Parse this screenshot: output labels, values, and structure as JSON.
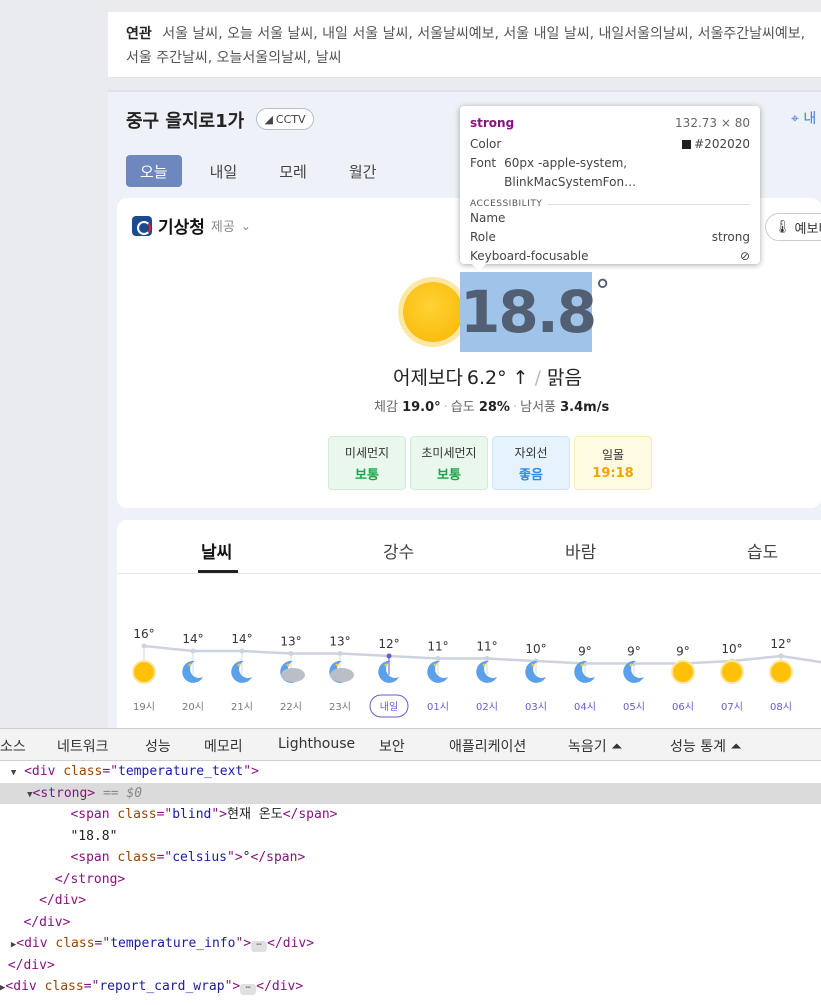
{
  "related": {
    "label": "연관",
    "text": "서울 날씨, 오늘 서울 날씨, 내일 서울 날씨, 서울날씨예보, 서울 내일 날씨, 내일서울의날씨, 서울주간날씨예보, 서울 주간날씨, 오늘서울의날씨, 날씨"
  },
  "weather": {
    "location": "중구 을지로1가",
    "cctv_label": "CCTV",
    "gps_label": "내",
    "tabs": [
      "오늘",
      "내일",
      "모레",
      "월간"
    ],
    "active_tab": "오늘",
    "agency": "기상청",
    "agency_sub": "제공",
    "forecast_btn": "예보비",
    "temperature": "18.8",
    "degree": "°",
    "compare_label": "어제보다",
    "compare_value": "6.2° ↑",
    "condition": "맑음",
    "feels_label": "체감",
    "feels_value": "19.0°",
    "humidity_label": "습도",
    "humidity_value": "28%",
    "wind_label": "남서풍",
    "wind_value": "3.4m/s",
    "badges": [
      {
        "label": "미세먼지",
        "value": "보통",
        "color": "#19a54a"
      },
      {
        "label": "초미세먼지",
        "value": "보통",
        "color": "#19a54a"
      },
      {
        "label": "자외선",
        "value": "좋음",
        "color": "#2f8de3"
      },
      {
        "label": "일몰",
        "value": "19:18",
        "color": "#f0a400"
      }
    ]
  },
  "hourly": {
    "tabs": [
      "날씨",
      "강수",
      "바람",
      "습도"
    ],
    "active_tab": "날씨",
    "temps": [
      16,
      14,
      14,
      13,
      13,
      12,
      11,
      11,
      10,
      9,
      9,
      9,
      10,
      12
    ],
    "hours": [
      "19시",
      "20시",
      "21시",
      "22시",
      "23시",
      "내일",
      "01시",
      "02시",
      "03시",
      "04시",
      "05시",
      "06시",
      "07시",
      "08시"
    ],
    "icons": [
      "sun-icon",
      "moon-icon",
      "moon-icon",
      "moon-cloud-icon",
      "moon-cloud-icon",
      "moon-icon",
      "moon-icon",
      "moon-icon",
      "moon-icon",
      "moon-icon",
      "moon-icon",
      "sun-icon",
      "sun-icon",
      "sun-icon"
    ]
  },
  "tooltip": {
    "tag": "strong",
    "size": "132.73 × 80",
    "color_label": "Color",
    "color_value": "#202020",
    "font_label": "Font",
    "font_value": "60px -apple-system, BlinkMacSystemFon…",
    "accessibility_label": "ACCESSIBILITY",
    "name_label": "Name",
    "name_value": "",
    "role_label": "Role",
    "role_value": "strong",
    "keyboard_label": "Keyboard-focusable"
  },
  "devtools": {
    "tabs": [
      "소스",
      "네트워크",
      "성능",
      "메모리",
      "Lighthouse",
      "보안",
      "애플리케이션",
      "녹음기 ⏶",
      "성능 통계 ⏶"
    ],
    "code": {
      "l1_class": "temperature_text",
      "l2_eq": "== $0",
      "l3_class": "blind",
      "l3_text": "현재 온도",
      "l4_text": "\"18.8\"",
      "l5_class": "celsius",
      "l5_text": "°",
      "l9_class": "temperature_info",
      "l11_class": "report_card_wrap"
    }
  }
}
